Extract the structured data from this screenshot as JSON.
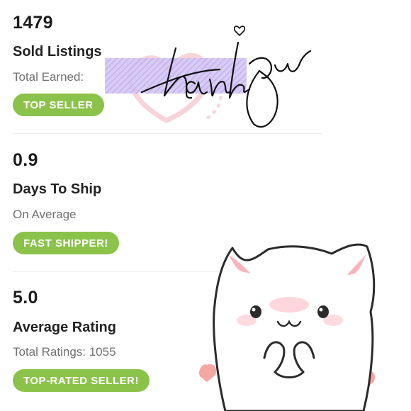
{
  "stats": [
    {
      "value": "1479",
      "title": "Sold Listings",
      "subtitle": "Total Earned:",
      "badge": "TOP SELLER"
    },
    {
      "value": "0.9",
      "title": "Days To Ship",
      "subtitle": "On Average",
      "badge": "FAST SHIPPER!"
    },
    {
      "value": "5.0",
      "title": "Average Rating",
      "subtitle": "Total Ratings: 1055",
      "badge": "TOP-RATED SELLER!"
    }
  ],
  "colors": {
    "badge_green": "#8bc34a",
    "highlight_purple": "#c9b6f2",
    "heart_pink": "#f8cfd4"
  },
  "stickers": {
    "signature": "thank you handwritten signature",
    "cat": "kawaii white cat with hearts"
  }
}
